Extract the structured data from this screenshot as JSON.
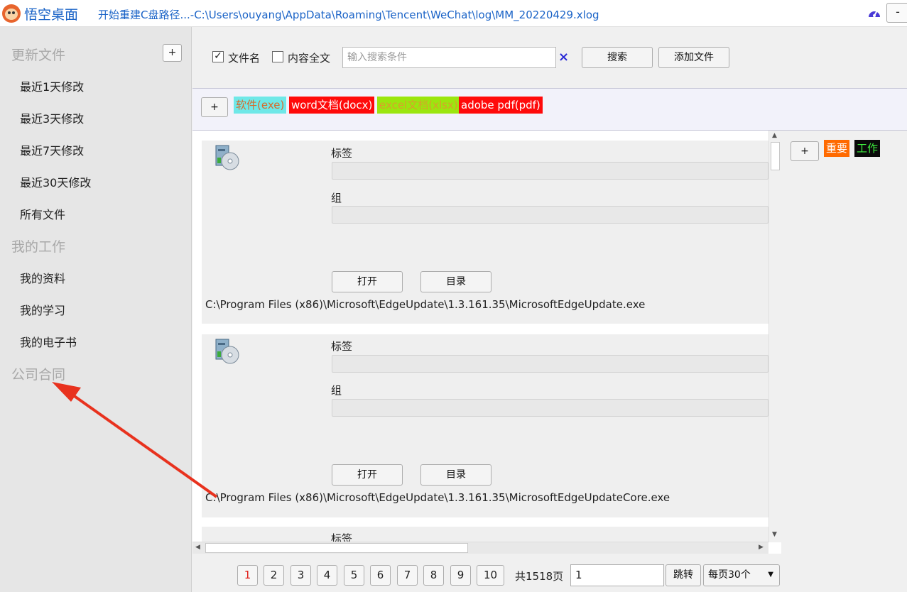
{
  "titlebar": {
    "app_title": "悟空桌面",
    "status": "开始重建C盘路径...-C:\\Users\\ouyang\\AppData\\Roaming\\Tencent\\WeChat\\log\\MM_20220429.xlog",
    "minimize_label": "-"
  },
  "sidebar": {
    "plus_label": "+",
    "sections": [
      {
        "heading": "更新文件",
        "items": [
          "最近1天修改",
          "最近3天修改",
          "最近7天修改",
          "最近30天修改",
          "所有文件"
        ]
      },
      {
        "heading": "我的工作",
        "items": [
          "我的资料",
          "我的学习",
          "我的电子书"
        ]
      },
      {
        "heading": "公司合同",
        "items": []
      }
    ]
  },
  "search": {
    "filename_checked": true,
    "filename_label": "文件名",
    "fulltext_checked": false,
    "fulltext_label": "内容全文",
    "placeholder": "输入搜索条件",
    "value": "",
    "clear_icon": "×",
    "search_button": "搜索",
    "add_file_button": "添加文件"
  },
  "file_type_tags": {
    "plus_label": "+",
    "tags": [
      {
        "label": "软件(exe)",
        "bg": "#6fe8e8",
        "fg": "#d9692a"
      },
      {
        "label": "word文档(docx)",
        "bg": "#ff0a0a",
        "fg": "#ffffff"
      },
      {
        "label": "excel文档(xlsx)",
        "bg": "#9be60f",
        "fg": "#d9a12a"
      },
      {
        "label": "adobe pdf(pdf)",
        "bg": "#ff0a0a",
        "fg": "#ffffff"
      }
    ]
  },
  "files": [
    {
      "tag_label": "标签",
      "group_label": "组",
      "open_button": "打开",
      "dir_button": "目录",
      "path": "C:\\Program Files (x86)\\Microsoft\\EdgeUpdate\\1.3.161.35\\MicrosoftEdgeUpdate.exe"
    },
    {
      "tag_label": "标签",
      "group_label": "组",
      "open_button": "打开",
      "dir_button": "目录",
      "path": "C:\\Program Files (x86)\\Microsoft\\EdgeUpdate\\1.3.161.35\\MicrosoftEdgeUpdateCore.exe"
    },
    {
      "tag_label": "标签"
    }
  ],
  "right_tags": {
    "plus_label": "+",
    "tags": [
      {
        "label": "重要",
        "bg": "#ff6a00",
        "fg": "#ffffff"
      },
      {
        "label": "工作",
        "bg": "#0a0a0a",
        "fg": "#3ef03e"
      }
    ]
  },
  "pagination": {
    "pages": [
      "1",
      "2",
      "3",
      "4",
      "5",
      "6",
      "7",
      "8",
      "9",
      "10"
    ],
    "current_page": "1",
    "total_label": "共1518页",
    "jump_value": "1",
    "jump_button": "跳转",
    "per_page": "每页30个"
  },
  "colors": {
    "accent_blue": "#1a63c7",
    "annotation_arrow": "#e8321e",
    "current_page": "#e0201a"
  }
}
